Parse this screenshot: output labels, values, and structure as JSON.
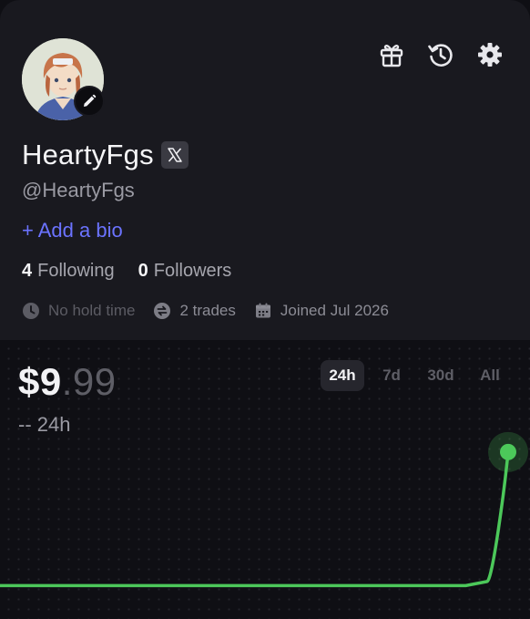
{
  "profile": {
    "display_name": "HeartyFgs",
    "handle": "@HeartyFgs",
    "add_bio": "+ Add a bio",
    "following_count": "4",
    "following_label": "Following",
    "followers_count": "0",
    "followers_label": "Followers",
    "hold_time": "No hold time",
    "trades": "2 trades",
    "joined": "Joined Jul 2026"
  },
  "icons": {
    "top": [
      "gift-icon",
      "history-icon",
      "settings-icon"
    ],
    "social": "x-logo-icon",
    "edit": "pencil-icon"
  },
  "chart": {
    "price_main": "$9",
    "price_cents": ".99",
    "change_text": "-- 24h",
    "tabs": [
      "24h",
      "7d",
      "30d",
      "All"
    ],
    "active_tab": "24h"
  },
  "colors": {
    "accent": "#6b73ff",
    "line": "#4cc85a",
    "card": "#19191f",
    "background": "#0f0f14"
  },
  "chart_data": {
    "type": "line",
    "x": [
      0,
      1,
      2,
      3,
      4,
      5,
      6,
      7,
      8,
      9,
      10,
      11,
      12,
      13,
      14,
      15,
      16,
      17,
      18,
      19,
      20,
      21,
      22,
      23,
      24
    ],
    "y": [
      0,
      0,
      0,
      0,
      0,
      0,
      0,
      0,
      0,
      0,
      0,
      0,
      0,
      0,
      0,
      0,
      0,
      0,
      0,
      0,
      0,
      0,
      0,
      0.3,
      9.99
    ],
    "ylim": [
      -1,
      11
    ],
    "xlabel": "",
    "ylabel": "",
    "title": "",
    "grid": false
  }
}
